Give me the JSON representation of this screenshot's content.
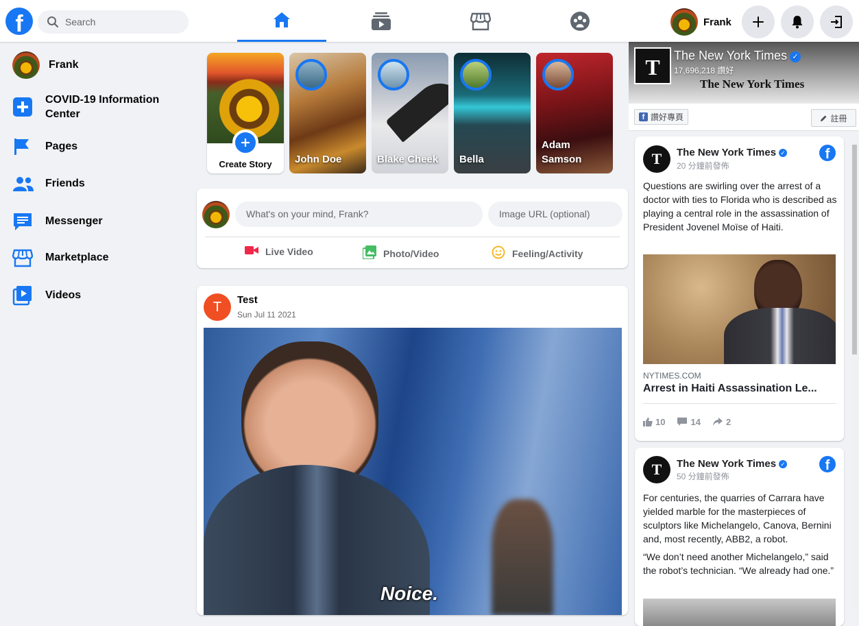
{
  "header": {
    "search_placeholder": "Search",
    "user_name": "Frank"
  },
  "sidebar": {
    "profile_name": "Frank",
    "items": [
      {
        "label": "COVID-19 Information Center",
        "icon": "plus-square-icon"
      },
      {
        "label": "Pages",
        "icon": "flag-icon"
      },
      {
        "label": "Friends",
        "icon": "friends-icon"
      },
      {
        "label": "Messenger",
        "icon": "messenger-icon"
      },
      {
        "label": "Marketplace",
        "icon": "store-icon"
      },
      {
        "label": "Videos",
        "icon": "video-play-icon"
      }
    ]
  },
  "stories": [
    {
      "name": "Create Story"
    },
    {
      "name": "John Doe"
    },
    {
      "name": "Blake Cheek"
    },
    {
      "name": "Bella"
    },
    {
      "name": "Adam Samson"
    }
  ],
  "composer": {
    "placeholder": "What's on your mind, Frank?",
    "image_placeholder": "Image URL (optional)",
    "actions": [
      "Live Video",
      "Photo/Video",
      "Feeling/Activity"
    ]
  },
  "post": {
    "avatar_letter": "T",
    "author": "Test",
    "date": "Sun Jul 11 2021",
    "image_caption": "Noice."
  },
  "page_plugin": {
    "page_name": "The New York Times",
    "likes": "17,696,218 讚好",
    "masthead": "The New York Times",
    "like_page_label": "讚好專頁",
    "signup_label": "註冊",
    "logo_letter": "T"
  },
  "nyt_posts": [
    {
      "author": "The New York Times",
      "time": "20 分鐘前發佈",
      "text": "Questions are swirling over the arrest of a doctor with ties to Florida who is described as playing a central role in the assassination of President Jovenel Moïse of Haiti.",
      "link_domain": "NYTIMES.COM",
      "link_title": "Arrest in Haiti Assassination Le...",
      "likes": "10",
      "comments": "14",
      "shares": "2"
    },
    {
      "author": "The New York Times",
      "time": "50 分鐘前發佈",
      "text": "For centuries, the quarries of Carrara have yielded marble for the masterpieces of sculptors like Michelangelo, Canova, Bernini and, most recently, ABB2, a robot.",
      "text2": "“We don’t need another Michelangelo,” said the robot’s technician. “We already had one.”"
    }
  ],
  "colors": {
    "accent": "#1877f2",
    "background": "#f0f2f5",
    "live_red": "#f02849",
    "photo_green": "#45bd62",
    "feeling_yellow": "#f7b928",
    "post_avatar": "#f04e23"
  }
}
